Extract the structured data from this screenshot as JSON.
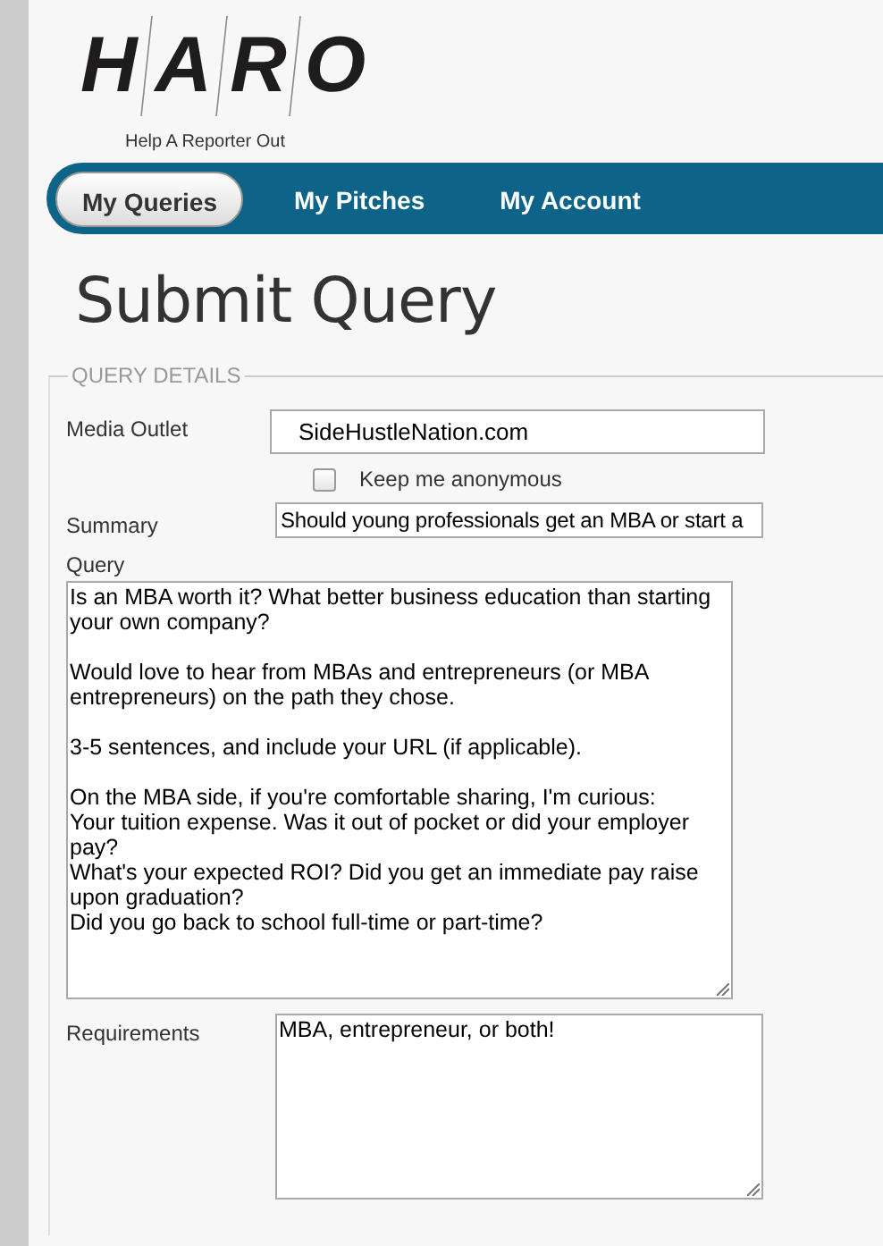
{
  "logo": {
    "letters": [
      "H",
      "A",
      "R",
      "O"
    ],
    "tagline": "Help A Reporter Out"
  },
  "tabs": [
    {
      "label": "My Queries",
      "selected": true
    },
    {
      "label": "My Pitches",
      "selected": false
    },
    {
      "label": "My Account",
      "selected": false
    }
  ],
  "page_title": "Submit Query",
  "section": {
    "legend": "QUERY DETAILS",
    "fields": [
      {
        "kind": "input",
        "label": "Media Outlet",
        "value": "SideHustleNation.com"
      },
      {
        "kind": "checkbox",
        "label": "Keep me anonymous",
        "checked": false
      },
      {
        "kind": "input",
        "label": "Summary",
        "value": "Should young professionals get an MBA or start a"
      },
      {
        "kind": "textarea",
        "label": "Query",
        "value": "Is an MBA worth it? What better business education than starting your own company?\n\nWould love to hear from MBAs and entrepreneurs (or MBA entrepreneurs) on the path they chose.\n\n3-5 sentences, and include your URL (if applicable).\n\nOn the MBA side, if you're comfortable sharing, I'm curious:\nYour tuition expense. Was it out of pocket or did your employer pay?\nWhat's your expected ROI? Did you get an immediate pay raise upon graduation?\nDid you go back to school full-time or part-time?"
      },
      {
        "kind": "textarea",
        "label": "Requirements",
        "value": "MBA, entrepreneur, or both!"
      }
    ]
  }
}
